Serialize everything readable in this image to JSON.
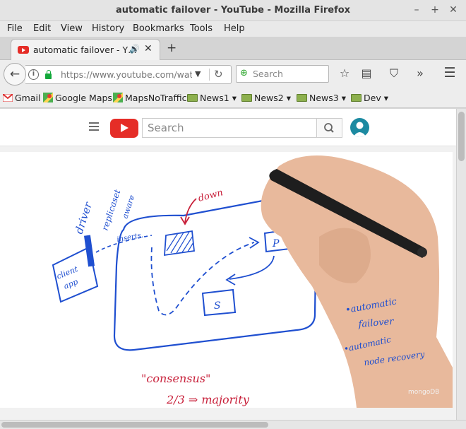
{
  "window": {
    "title": "automatic failover - YouTube - Mozilla Firefox",
    "controls": {
      "minimize": "–",
      "maximize": "+",
      "close": "✕"
    }
  },
  "menu": [
    "File",
    "Edit",
    "View",
    "History",
    "Bookmarks",
    "Tools",
    "Help"
  ],
  "tabs": [
    {
      "title": "automatic failover - Y…",
      "icon": "youtube-icon",
      "audio_icon": "🔊",
      "close": "✕"
    }
  ],
  "new_tab": "+",
  "navigation": {
    "back": "←",
    "url": "https://www.youtube.com/watch?",
    "url_dropdown": "▼",
    "reload": "↻",
    "search_placeholder": "Search",
    "search_engine_icon": "⊕",
    "icons": [
      "bookmark-star-icon",
      "reading-list-icon",
      "pocket-icon",
      "overflow-icon",
      "hamburger-menu-icon"
    ],
    "glyphs": {
      "star": "☆",
      "list": "▤",
      "pocket": "⛉",
      "more": "»",
      "menu": "☰"
    }
  },
  "bookmarks": [
    {
      "label": "Gmail",
      "icon": "gmail-icon"
    },
    {
      "label": "Google Maps",
      "icon": "maps-pin-icon"
    },
    {
      "label": "MapsNoTraffic",
      "icon": "maps-pin-icon"
    },
    {
      "label": "News1",
      "icon": "folder-icon",
      "dropdown": true
    },
    {
      "label": "News2",
      "icon": "folder-icon",
      "dropdown": true
    },
    {
      "label": "News3",
      "icon": "folder-icon",
      "dropdown": true
    },
    {
      "label": "Dev",
      "icon": "folder-icon",
      "dropdown": true
    }
  ],
  "youtube": {
    "search_placeholder": "Search",
    "brand_color": "#e52d27"
  },
  "whiteboard": {
    "left_labels": [
      "client",
      "app",
      "driver",
      "replicaset",
      "aware",
      "inserts..."
    ],
    "nodes": [
      "P",
      "S"
    ],
    "arrow_label": "down",
    "right_notes": [
      "•automatic",
      "failover",
      "•automatic",
      "node recovery"
    ],
    "bottom_notes": [
      "\"consensus\"",
      "2/3 ⇒ majority"
    ],
    "watermark": "mongoDB",
    "ink_blue": "#1f4fd0",
    "ink_red": "#c8203a"
  },
  "colors": {
    "lock": "#12a83a",
    "folder": "#8db04e"
  }
}
